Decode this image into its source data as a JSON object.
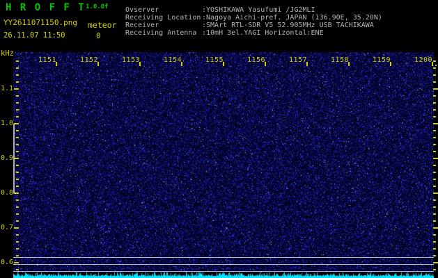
{
  "app": {
    "title": "H R O F F T",
    "version": "1.0.0f",
    "filename": "YY2611071150.png",
    "mode_label": "meteor",
    "meteor_count": "0",
    "timestamp": "26.11.07 11:50"
  },
  "station_info": {
    "rows": [
      {
        "label": "Ovserver",
        "value": ":YOSHIKAWA Yasufumi /JG2MLI"
      },
      {
        "label": "Receiving Location",
        "value": ":Nagoya Aichi-pref. JAPAN (136.90E, 35.20N)"
      },
      {
        "label": "Receiver",
        "value": ":SMArt RTL-SDR V5 52.905MHz USB TACHIKAWA"
      },
      {
        "label": "Receiving Antenna",
        "value": ":10mH 3el.YAGI Horizontal:ENE"
      }
    ]
  },
  "chart_data": {
    "type": "heatmap",
    "x_axis": {
      "unit": "time HHMM",
      "tick_labels": [
        "1151",
        "1152",
        "1153",
        "1154",
        "1155",
        "1156",
        "1157",
        "1158",
        "1159",
        "1200"
      ],
      "span_minutes": 10
    },
    "y_axis": {
      "unit": "kHz",
      "tick_labels": [
        "1.1",
        "1.0",
        "0.9",
        "0.8",
        "0.7",
        "0.6"
      ],
      "approx_range": [
        0.58,
        1.21
      ]
    },
    "reference_lines_khz": [
      0.62,
      0.6,
      0.58
    ],
    "series": [
      {
        "name": "spectrogram",
        "description": "uniform dark blue background noise field, no meteor echoes visible"
      },
      {
        "name": "signal-level-trace",
        "description": "cyan noise level bar trace along the bottom edge"
      }
    ],
    "grid": false,
    "legend": "none"
  },
  "colors": {
    "background": "#000000",
    "title_green": "#00c800",
    "label_yellow": "#d2d200",
    "info_gray": "#b4b4b4",
    "signal_cyan": "#00e2ff",
    "reference_gray": "#b8b8b8"
  }
}
